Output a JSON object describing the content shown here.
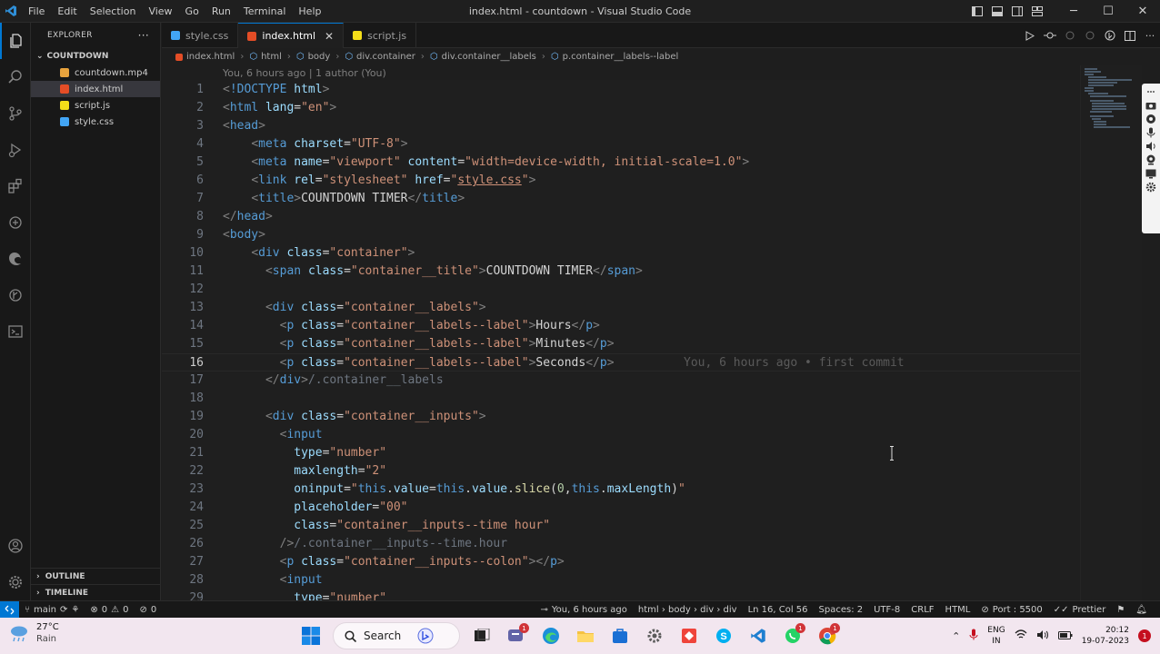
{
  "titlebar": {
    "menu": [
      "File",
      "Edit",
      "Selection",
      "View",
      "Go",
      "Run",
      "Terminal",
      "Help"
    ],
    "window_title": "index.html - countdown - Visual Studio Code"
  },
  "sidebar": {
    "header": "EXPLORER",
    "folder": "COUNTDOWN",
    "files": [
      {
        "name": "countdown.mp4",
        "icon": "video-file-icon",
        "color": "#e8a33d"
      },
      {
        "name": "index.html",
        "icon": "html-file-icon",
        "color": "#e44d26"
      },
      {
        "name": "script.js",
        "icon": "js-file-icon",
        "color": "#f5de19"
      },
      {
        "name": "style.css",
        "icon": "css-file-icon",
        "color": "#42a5f5"
      }
    ],
    "outline": "OUTLINE",
    "timeline": "TIMELINE"
  },
  "tabs": [
    {
      "label": "style.css",
      "icon": "css-file-icon"
    },
    {
      "label": "index.html",
      "icon": "html-file-icon",
      "active": true
    },
    {
      "label": "script.js",
      "icon": "js-file-icon"
    }
  ],
  "breadcrumb": [
    "index.html",
    "html",
    "body",
    "div.container",
    "div.container__labels",
    "p.container__labels--label"
  ],
  "blame_top": "You, 6 hours ago | 1 author (You)",
  "inline_blame": "You, 6 hours ago • first commit",
  "editor": {
    "current_line": 16,
    "lines": [
      {
        "n": "1",
        "text": "<!DOCTYPE html>"
      },
      {
        "n": "2",
        "text": "<html lang=\"en\">"
      },
      {
        "n": "3",
        "text": "<head>"
      },
      {
        "n": "4",
        "text": "    <meta charset=\"UTF-8\">"
      },
      {
        "n": "5",
        "text": "    <meta name=\"viewport\" content=\"width=device-width, initial-scale=1.0\">"
      },
      {
        "n": "6",
        "text": "    <link rel=\"stylesheet\" href=\"style.css\">"
      },
      {
        "n": "7",
        "text": "    <title>COUNTDOWN TIMER</title>"
      },
      {
        "n": "8",
        "text": "</head>"
      },
      {
        "n": "9",
        "text": "<body>"
      },
      {
        "n": "10",
        "text": "    <div class=\"container\">"
      },
      {
        "n": "11",
        "text": "      <span class=\"container__title\">COUNTDOWN TIMER</span>"
      },
      {
        "n": "12",
        "text": ""
      },
      {
        "n": "13",
        "text": "      <div class=\"container__labels\">"
      },
      {
        "n": "14",
        "text": "        <p class=\"container__labels--label\">Hours</p>"
      },
      {
        "n": "15",
        "text": "        <p class=\"container__labels--label\">Minutes</p>"
      },
      {
        "n": "16",
        "text": "        <p class=\"container__labels--label\">Seconds</p>"
      },
      {
        "n": "17",
        "text": "      </div>/.container__labels"
      },
      {
        "n": "18",
        "text": ""
      },
      {
        "n": "19",
        "text": "      <div class=\"container__inputs\">"
      },
      {
        "n": "20",
        "text": "        <input"
      },
      {
        "n": "21",
        "text": "          type=\"number\""
      },
      {
        "n": "22",
        "text": "          maxlength=\"2\""
      },
      {
        "n": "23",
        "text": "          oninput=\"this.value=this.value.slice(0,this.maxLength)\""
      },
      {
        "n": "24",
        "text": "          placeholder=\"00\""
      },
      {
        "n": "25",
        "text": "          class=\"container__inputs--time hour\""
      },
      {
        "n": "26",
        "text": "        />/.container__inputs--time.hour"
      },
      {
        "n": "27",
        "text": "        <p class=\"container__inputs--colon\"></p>"
      },
      {
        "n": "28",
        "text": "        <input"
      },
      {
        "n": "29",
        "text": "          type=\"number\""
      }
    ]
  },
  "statusbar": {
    "branch": "main",
    "errors": "0",
    "warnings": "0",
    "ports": "0",
    "blame": "You, 6 hours ago",
    "path": "html › body › div › div",
    "position": "Ln 16, Col 56",
    "spaces": "Spaces: 2",
    "encoding": "UTF-8",
    "eol": "CRLF",
    "language": "HTML",
    "port": "Port : 5500",
    "prettier": "Prettier"
  },
  "taskbar": {
    "weather_temp": "27°C",
    "weather_desc": "Rain",
    "search": "Search",
    "lang_top": "ENG",
    "lang_bottom": "IN",
    "time": "20:12",
    "date": "19-07-2023",
    "notif_count": "1",
    "teams_badge": "1",
    "whatsapp_badge": "1",
    "chrome_badge": "1"
  }
}
